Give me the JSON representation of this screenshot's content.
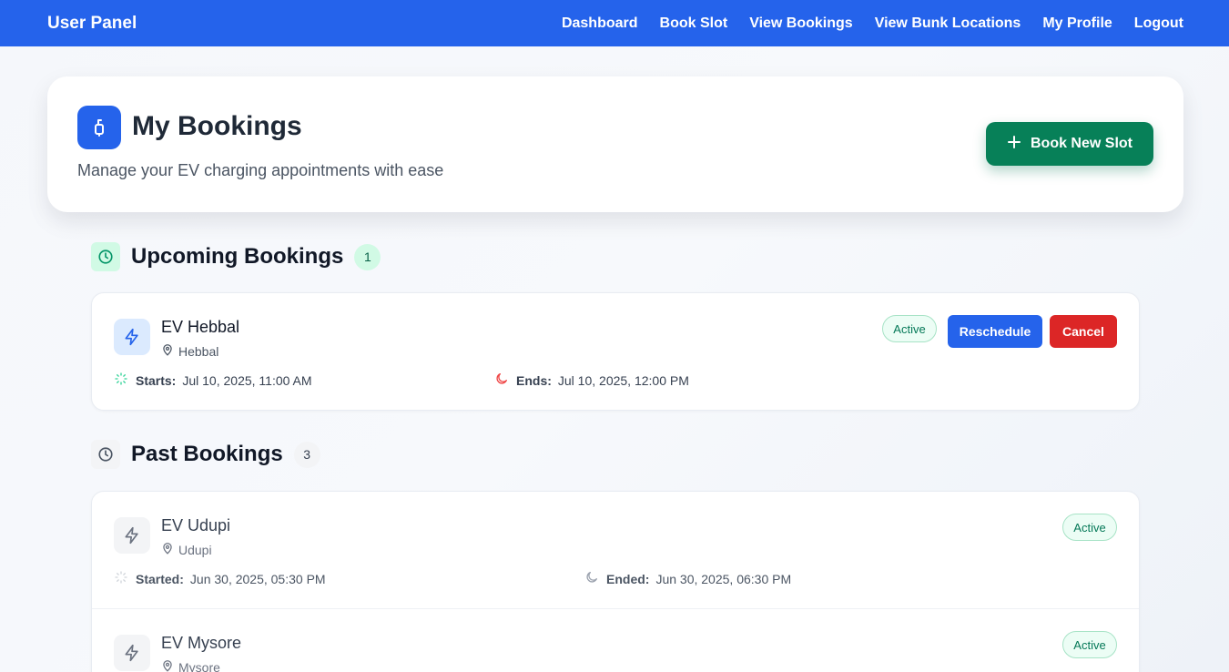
{
  "nav": {
    "brand": "User Panel",
    "links": [
      "Dashboard",
      "Book Slot",
      "View Bookings",
      "View Bunk Locations",
      "My Profile",
      "Logout"
    ]
  },
  "header": {
    "title": "My Bookings",
    "subtitle": "Manage your EV charging appointments with ease",
    "book_new_label": "Book New Slot"
  },
  "upcoming": {
    "title": "Upcoming Bookings",
    "count": "1",
    "bookings": [
      {
        "name": "EV Hebbal",
        "location": "Hebbal",
        "start_label": "Starts:",
        "start": "Jul 10, 2025, 11:00 AM",
        "end_label": "Ends:",
        "end": "Jul 10, 2025, 12:00 PM",
        "status": "Active",
        "reschedule_label": "Reschedule",
        "cancel_label": "Cancel"
      }
    ]
  },
  "past": {
    "title": "Past Bookings",
    "count": "3",
    "bookings": [
      {
        "name": "EV Udupi",
        "location": "Udupi",
        "start_label": "Started:",
        "start": "Jun 30, 2025, 05:30 PM",
        "end_label": "Ended:",
        "end": "Jun 30, 2025, 06:30 PM",
        "status": "Active"
      },
      {
        "name": "EV Mysore",
        "location": "Mysore",
        "status": "Active"
      }
    ]
  },
  "colors": {
    "primary": "#2563eb",
    "success": "#078058",
    "danger": "#dc2626",
    "active_badge_bg": "#ecfdf5"
  },
  "icons": {
    "header": "plug-icon",
    "upcoming": "clock-icon",
    "past": "clock-icon",
    "station": "lightning-icon",
    "location": "map-pin-icon",
    "start": "loader-icon",
    "end": "moon-icon",
    "add": "plus-icon"
  }
}
